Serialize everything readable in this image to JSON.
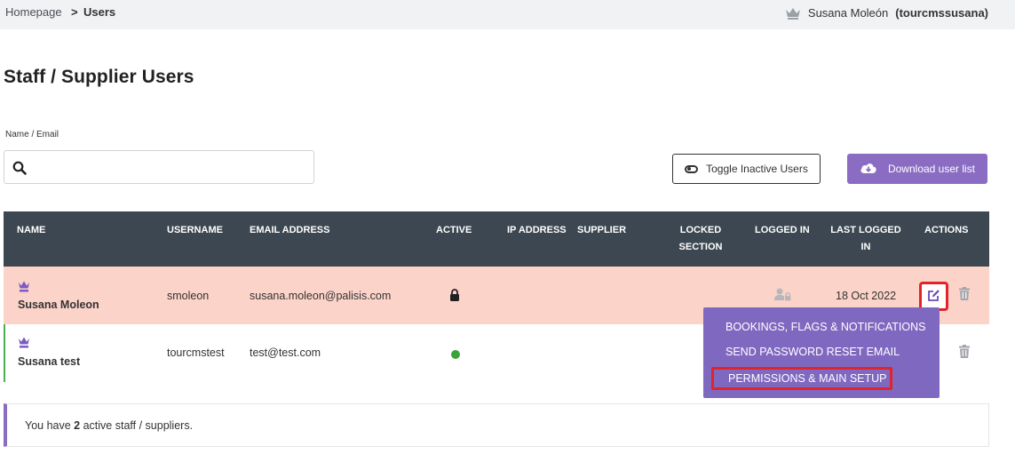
{
  "breadcrumb": {
    "home": "Homepage",
    "separator": ">",
    "current": "Users"
  },
  "current_user": {
    "name": "Susana Moleón",
    "username_display": "(tourcmssusana)"
  },
  "page": {
    "title": "Staff / Supplier Users"
  },
  "search": {
    "label": "Name / Email",
    "value": ""
  },
  "toolbar": {
    "toggle_label": "Toggle Inactive Users",
    "download_label": "Download user list"
  },
  "table": {
    "columns": {
      "name": "NAME",
      "username": "USERNAME",
      "email": "EMAIL ADDRESS",
      "active": "ACTIVE",
      "ip": "IP ADDRESS",
      "supplier": "SUPPLIER",
      "locked_1": "LOCKED",
      "locked_2": "SECTION",
      "logged_in": "LOGGED IN",
      "last_logged_1": "LAST LOGGED",
      "last_logged_2": "IN",
      "actions": "ACTIONS"
    },
    "rows": [
      {
        "name": "Susana Moleon",
        "username": "smoleon",
        "email": "susana.moleon@palisis.com",
        "active_icon": "lock-icon",
        "logged_in_icon": "user-lock-icon",
        "last_logged_in": "18 Oct 2022"
      },
      {
        "name": "Susana test",
        "username": "tourcmstest",
        "email": "test@test.com",
        "active_icon": "active-dot"
      }
    ]
  },
  "actions_menu": {
    "items": [
      "BOOKINGS, FLAGS & NOTIFICATIONS",
      "SEND PASSWORD RESET EMAIL",
      "PERMISSIONS & MAIN SETUP"
    ]
  },
  "notice": {
    "prefix": "You have",
    "count": "2",
    "suffix": "active staff / suppliers."
  },
  "colors": {
    "accent": "#8a6cc3",
    "header": "#3c4751",
    "highlight_row": "#fcd3c9",
    "callout": "#e0242b",
    "active": "#3ca23a"
  }
}
